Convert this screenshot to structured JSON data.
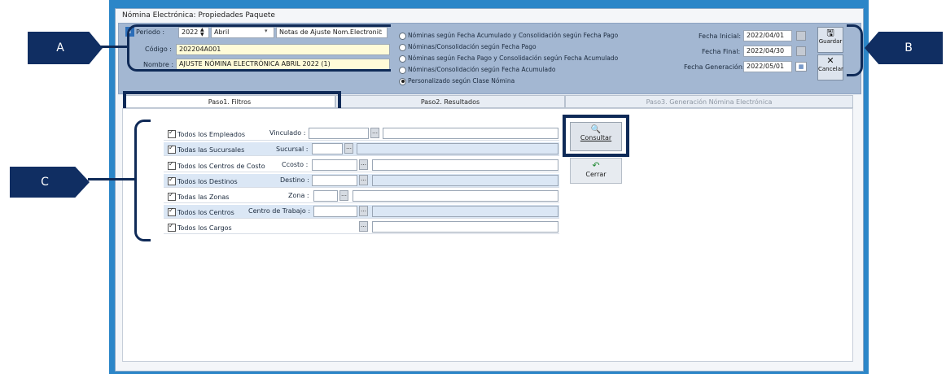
{
  "window": {
    "title": "Nómina Electrónica: Propiedades Paquete"
  },
  "header": {
    "periodo_label": "Periodo :",
    "year": "2022",
    "month": "Abril",
    "tipo": "Notas de Ajuste Nom.Electronic",
    "codigo_label": "Código :",
    "codigo": "202204A001",
    "nombre_label": "Nombre :",
    "nombre": "AJUSTE NÓMINA ELECTRÓNICA ABRIL 2022 (1)",
    "options": [
      "Nóminas según Fecha Acumulado y Consolidación según Fecha Pago",
      "Nóminas/Consolidación según Fecha Pago",
      "Nóminas según Fecha Pago y Consolidación según Fecha Acumulado",
      "Nóminas/Consolidación según Fecha Acumulado",
      "Personalizado según Clase Nómina"
    ],
    "selected_option": 4,
    "fecha_inicial_label": "Fecha Inicial:",
    "fecha_inicial": "2022/04/01",
    "fecha_final_label": "Fecha Final:",
    "fecha_final": "2022/04/30",
    "fecha_generacion_label": "Fecha Generación:",
    "fecha_generacion": "2022/05/01"
  },
  "toolbar": {
    "guardar": "Guardar",
    "cancelar": "Cancelar"
  },
  "tabs": [
    "Paso1. Filtros",
    "Paso2. Resultados",
    "Paso3. Generación Nómina Electrónica"
  ],
  "filters": [
    {
      "check_label": "Todos los Empleados",
      "field_label": "Vinculado :"
    },
    {
      "check_label": "Todas las Sucursales",
      "field_label": "Sucursal :"
    },
    {
      "check_label": "Todos los Centros de Costo",
      "field_label": "Ccosto :"
    },
    {
      "check_label": "Todos los Destinos",
      "field_label": "Destino :"
    },
    {
      "check_label": "Todas las Zonas",
      "field_label": "Zona :"
    },
    {
      "check_label": "Todos los Centros",
      "field_label": "Centro de Trabajo :"
    },
    {
      "check_label": "Todos los Cargos",
      "field_label": ""
    }
  ],
  "actions": {
    "consultar": "Consultar",
    "cerrar": "Cerrar"
  },
  "callouts": {
    "a": "A",
    "b": "B",
    "c": "C"
  },
  "colors": {
    "callout": "#102e62",
    "frame": "#2c86c8",
    "header": "#a3b7d2"
  }
}
